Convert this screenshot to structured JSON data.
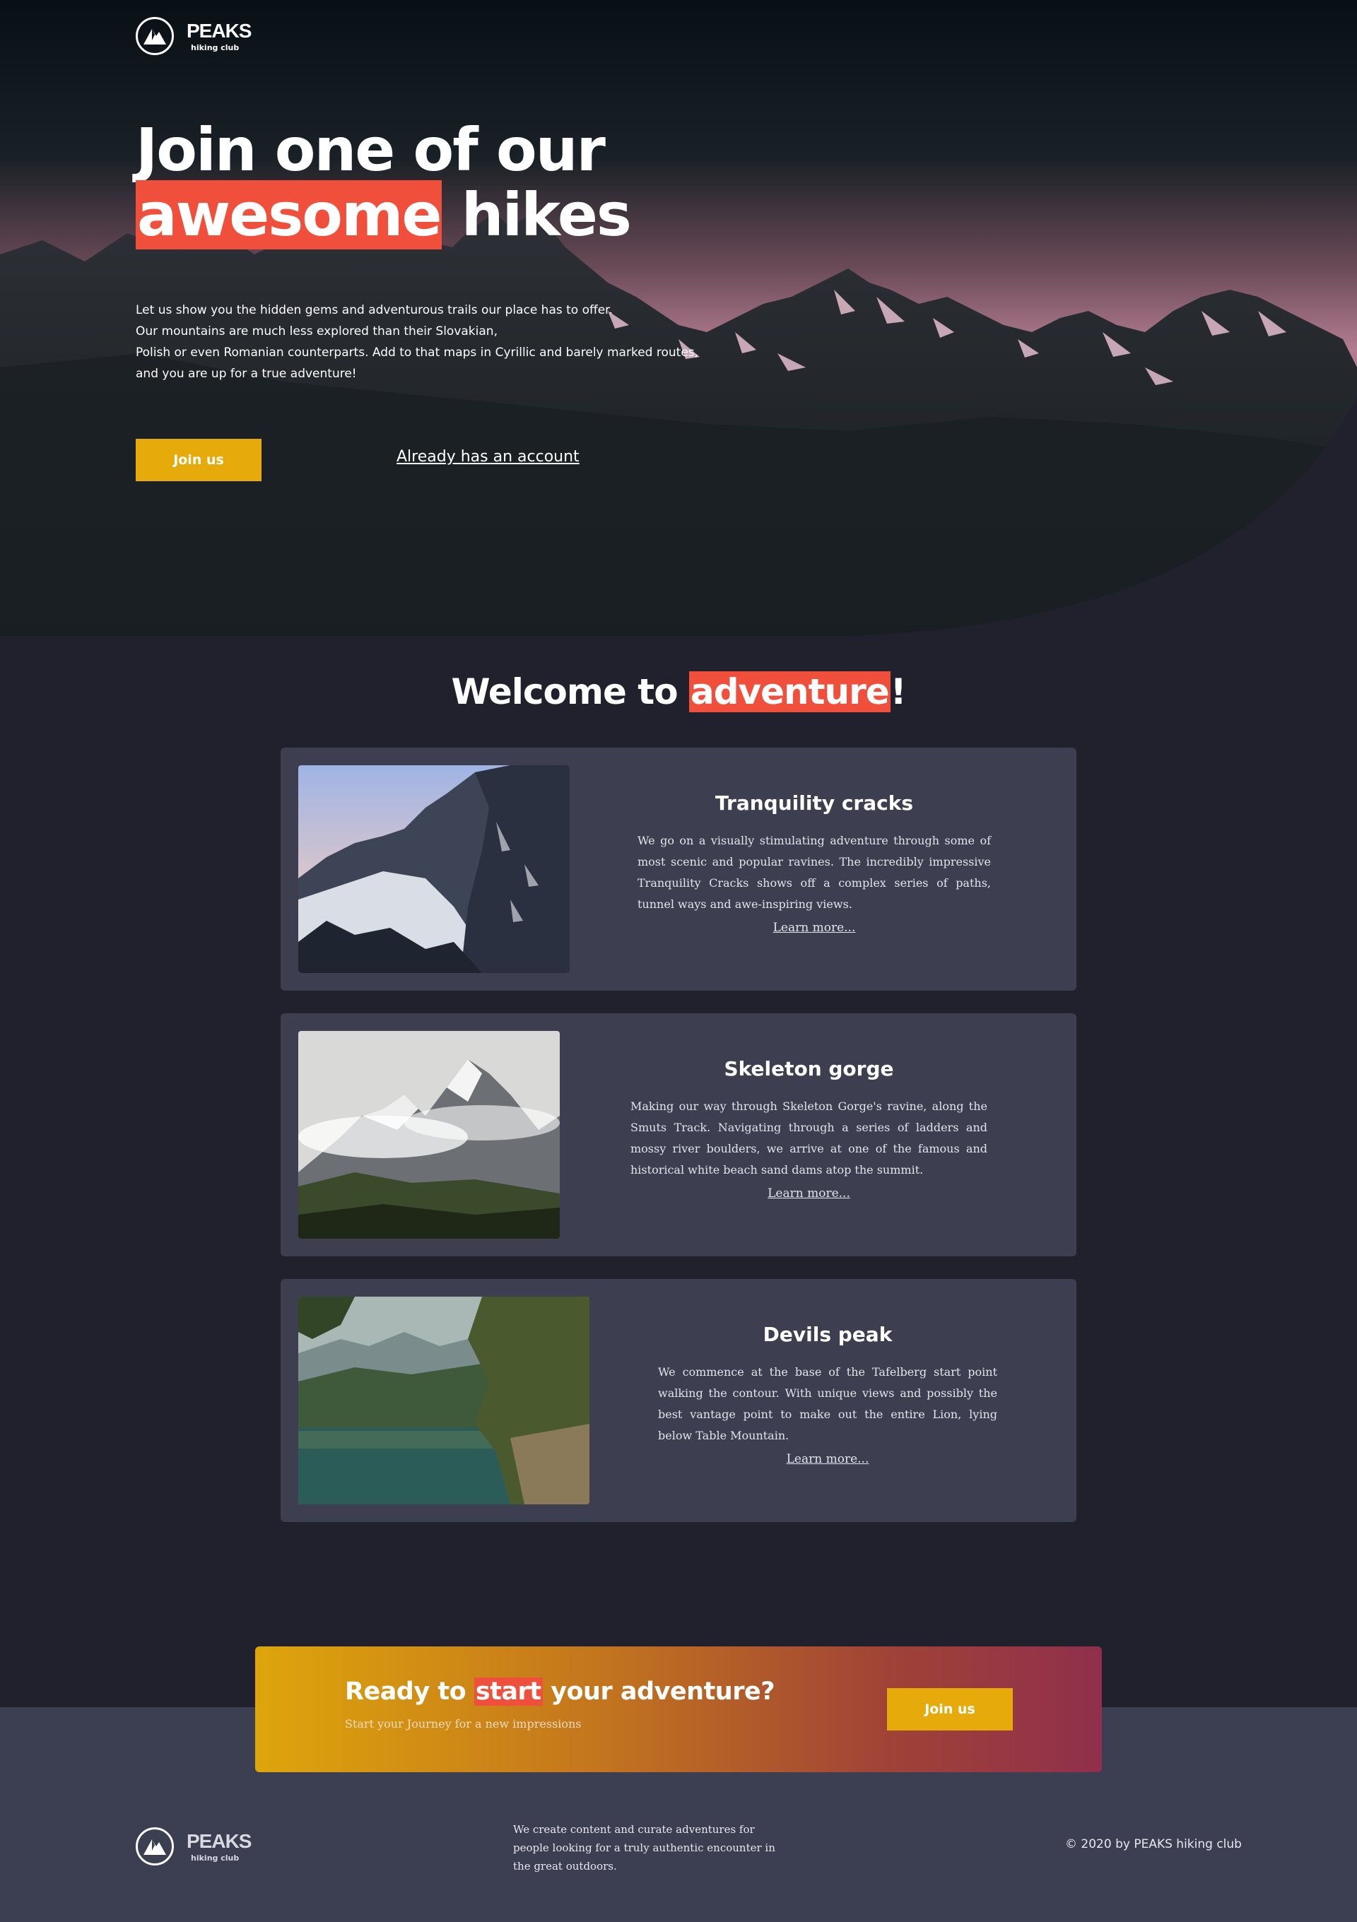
{
  "brand": {
    "name": "PEAKS",
    "tagline": "hiking club"
  },
  "hero": {
    "title_line1": "Join one of our",
    "title_highlight": "awesome",
    "title_line2_rest": " hikes",
    "paragraph": [
      "Let us show you the hidden gems and adventurous trails our place has to offer.",
      "Our mountains are much less explored than their Slovakian,",
      "Polish or even Romanian counterparts. Add to that maps in Cyrillic and barely marked routes,",
      "and you are up for a true adventure!"
    ],
    "join_label": "Join us",
    "account_link": "Already has an account"
  },
  "welcome": {
    "title_prefix": "Welcome to ",
    "title_highlight": "adventure",
    "title_suffix": "!"
  },
  "hikes": [
    {
      "title": "Tranquility cracks",
      "description": "We go on a visually stimulating adventure through some of most scenic and popular ravines. The incredibly impressive Tranquility Cracks shows off a complex series of paths, tunnel ways and awe-inspiring views.",
      "link": "Learn more..."
    },
    {
      "title": "Skeleton gorge",
      "description": "Making our way through Skeleton Gorge's ravine, along the Smuts Track. Navigating through a series of ladders and mossy river boulders, we arrive at one of the famous and historical white beach sand dams atop the summit.",
      "link": "Learn more..."
    },
    {
      "title": "Devils peak",
      "description": "We commence at the base of the Tafelberg start point walking the contour. With unique views and possibly the best vantage point to make out the entire Lion, lying below Table Mountain.",
      "link": "Learn more..."
    }
  ],
  "cta": {
    "title_prefix": "Ready to ",
    "title_highlight": "start",
    "title_suffix": " your adventure?",
    "subtitle": "Start your Journey for a new impressions",
    "join_label": "Join us"
  },
  "footer": {
    "about": "We create content and curate adventures for people looking for a truly authentic encounter in the great outdoors.",
    "copyright": "© 2020 by PEAKS hiking club"
  },
  "colors": {
    "accent": "#f0503b",
    "gold": "#e6aa0a",
    "background": "#20212c",
    "card": "#3d3f50",
    "footer": "#3c3e51"
  },
  "icons": {
    "logo": "mountain-peak-logo-icon"
  }
}
